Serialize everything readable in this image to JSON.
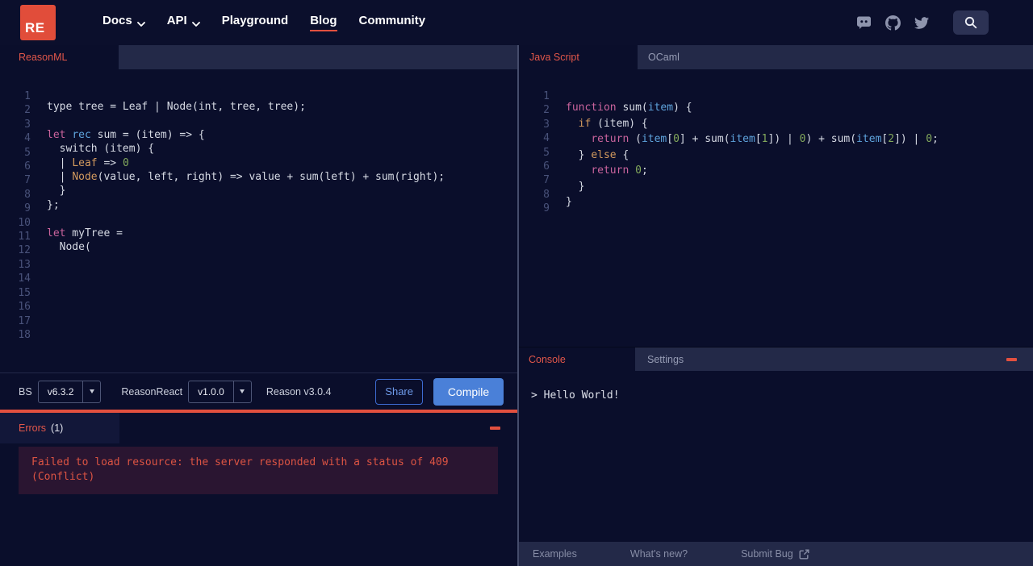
{
  "nav": {
    "logo": "RE",
    "items": [
      {
        "label": "Docs",
        "dropdown": true,
        "active": false
      },
      {
        "label": "API",
        "dropdown": true,
        "active": false
      },
      {
        "label": "Playground",
        "dropdown": false,
        "active": false
      },
      {
        "label": "Blog",
        "dropdown": false,
        "active": true
      },
      {
        "label": "Community",
        "dropdown": false,
        "active": false
      }
    ],
    "icons": [
      "discord-icon",
      "github-icon",
      "twitter-icon"
    ],
    "search_icon": "search-icon"
  },
  "left_panel": {
    "tab_label": "ReasonML",
    "editor_lines": [
      [
        [
          "p",
          "type tree = Leaf | Node(int, tree, tree);"
        ]
      ],
      [],
      [
        [
          "k",
          "let"
        ],
        [
          "p",
          " "
        ],
        [
          "b",
          "rec"
        ],
        [
          "p",
          " sum = (item) => {"
        ]
      ],
      [
        [
          "p",
          "  switch (item) {"
        ]
      ],
      [
        [
          "p",
          "  | "
        ],
        [
          "o",
          "Leaf"
        ],
        [
          "p",
          " => "
        ],
        [
          "g",
          "0"
        ]
      ],
      [
        [
          "p",
          "  | "
        ],
        [
          "o",
          "Node"
        ],
        [
          "p",
          "(value, left, right) => value + sum(left) + sum(right);"
        ]
      ],
      [
        [
          "p",
          "  }"
        ]
      ],
      [
        [
          "p",
          "};"
        ]
      ],
      [],
      [
        [
          "k",
          "let"
        ],
        [
          "p",
          " myTree ="
        ]
      ],
      [
        [
          "p",
          "  Node("
        ]
      ],
      [],
      [],
      [],
      [],
      [],
      [],
      []
    ],
    "toolbar": {
      "bs_label": "BS",
      "bs_version": "v6.3.2",
      "reasonreact_label": "ReasonReact",
      "reasonreact_version": "v1.0.0",
      "reason_version": "Reason v3.0.4",
      "share_label": "Share",
      "compile_label": "Compile"
    },
    "errors": {
      "title": "Errors",
      "count": "(1)",
      "message": "Failed to load resource: the server responded with a status of 409 (Conflict)"
    }
  },
  "right_panel": {
    "tabs": [
      {
        "label": "Java Script",
        "active": true
      },
      {
        "label": "OCaml",
        "active": false
      }
    ],
    "editor_lines": [
      [
        [
          "k",
          "function"
        ],
        [
          "p",
          " sum("
        ],
        [
          "b",
          "item"
        ],
        [
          "p",
          ") {"
        ]
      ],
      [
        [
          "p",
          "  "
        ],
        [
          "o",
          "if"
        ],
        [
          "p",
          " (item) {"
        ]
      ],
      [
        [
          "p",
          "    "
        ],
        [
          "k",
          "return"
        ],
        [
          "p",
          " ("
        ],
        [
          "b",
          "item"
        ],
        [
          "p",
          "["
        ],
        [
          "g",
          "0"
        ],
        [
          "p",
          "] + sum("
        ],
        [
          "b",
          "item"
        ],
        [
          "p",
          "["
        ],
        [
          "g",
          "1"
        ],
        [
          "p",
          "]) | "
        ],
        [
          "g",
          "0"
        ],
        [
          "p",
          ") + sum("
        ],
        [
          "b",
          "item"
        ],
        [
          "p",
          "["
        ],
        [
          "g",
          "2"
        ],
        [
          "p",
          "]) | "
        ],
        [
          "g",
          "0"
        ],
        [
          "p",
          ";"
        ]
      ],
      [
        [
          "p",
          "  } "
        ],
        [
          "o",
          "else"
        ],
        [
          "p",
          " {"
        ]
      ],
      [
        [
          "p",
          "    "
        ],
        [
          "k",
          "return"
        ],
        [
          "p",
          " "
        ],
        [
          "g",
          "0"
        ],
        [
          "p",
          ";"
        ]
      ],
      [
        [
          "p",
          "  }"
        ]
      ],
      [
        [
          "p",
          "}"
        ]
      ],
      [],
      []
    ],
    "console": {
      "tabs": [
        {
          "label": "Console",
          "active": true
        },
        {
          "label": "Settings",
          "active": false
        }
      ],
      "output": "> Hello World!"
    },
    "footer": [
      {
        "label": "Examples",
        "external": false
      },
      {
        "label": "What's new?",
        "external": false
      },
      {
        "label": "Submit Bug",
        "external": true
      }
    ]
  },
  "colors": {
    "accent_red": "#e2503f",
    "logo_red": "#e14d3a",
    "button_blue": "#4a80d8",
    "bg_dark": "#0a0e2b",
    "bg_raised": "#232948",
    "error_box_bg": "#2a1531"
  }
}
